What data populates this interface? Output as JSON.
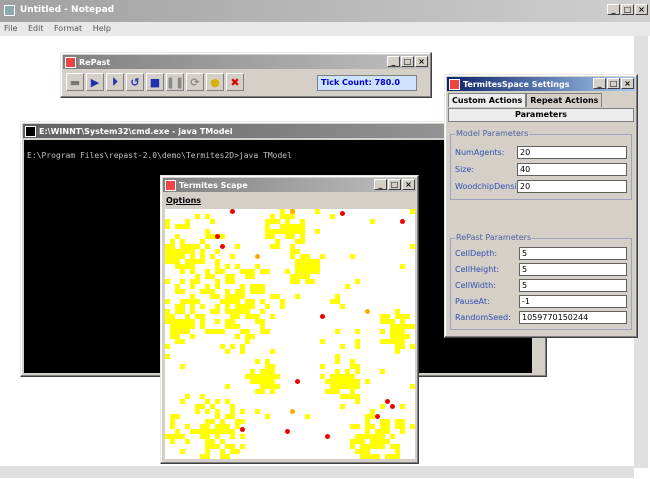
{
  "notepad": {
    "title": "Untitled - Notepad",
    "menu": [
      "File",
      "Edit",
      "Format",
      "Help"
    ]
  },
  "repast": {
    "title": "RePast",
    "tick_count": "Tick Count: 780.0",
    "tools": [
      "setup-icon",
      "run-icon",
      "step-icon",
      "reset-icon",
      "stop-square-icon",
      "pause-icon",
      "loop-icon",
      "lightbulb-icon",
      "exit-icon"
    ]
  },
  "cmd": {
    "title": "E:\\WINNT\\System32\\cmd.exe - java TModel",
    "line": "E:\\Program Files\\repast-2.0\\demo\\Termites2D>java TModel"
  },
  "scape": {
    "title": "Termites Scape",
    "menu": "Options"
  },
  "settings": {
    "title": "TermitesSpace Settings",
    "tabs": [
      "Custom Actions",
      "Repeat Actions"
    ],
    "header": "Parameters",
    "model_group": "Model Parameters",
    "model_params": [
      {
        "label": "NumAgents:",
        "value": "20"
      },
      {
        "label": "Size:",
        "value": "40"
      },
      {
        "label": "WoodchipDensity:",
        "value": "20"
      }
    ],
    "repast_group": "RePast Parameters",
    "repast_params": [
      {
        "label": "CellDepth:",
        "value": "5"
      },
      {
        "label": "CellHeight:",
        "value": "5"
      },
      {
        "label": "CellWidth:",
        "value": "5"
      },
      {
        "label": "PauseAt:",
        "value": "-1"
      },
      {
        "label": "RandomSeed:",
        "value": "1059770150244"
      }
    ]
  },
  "window_buttons": {
    "minimize": "_",
    "maximize": "□",
    "close": "×"
  },
  "colors": {
    "woodchip": "#ffff00",
    "termite_red": "#ee0000",
    "termite_orange": "#ffaa00",
    "tick_text": "#0000cc"
  }
}
